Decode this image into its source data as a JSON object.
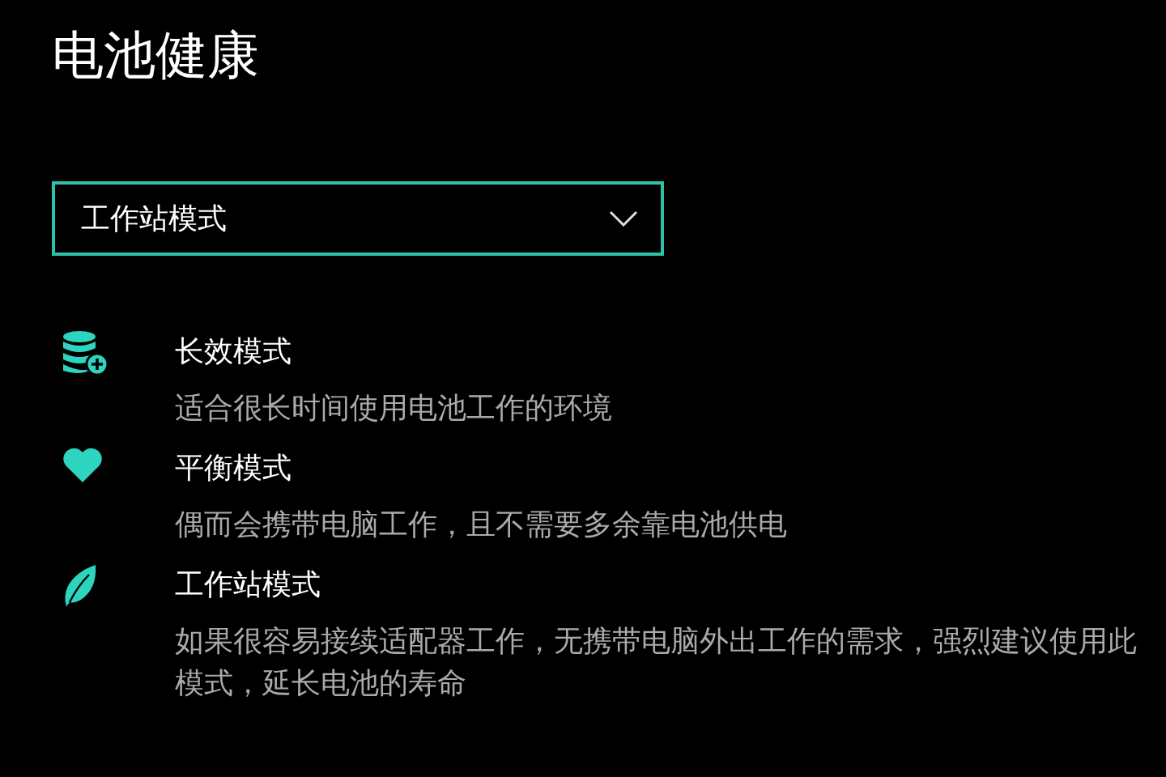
{
  "title": "电池健康",
  "dropdown": {
    "value": "工作站模式"
  },
  "modes": [
    {
      "kind": "database",
      "name": "长效模式",
      "description": "适合很长时间使用电池工作的环境"
    },
    {
      "kind": "heart",
      "name": "平衡模式",
      "description": "偶而会携带电脑工作，且不需要多余靠电池供电"
    },
    {
      "kind": "leaf",
      "name": "工作站模式",
      "description": "如果很容易接续适配器工作，无携带电脑外出工作的需求，强烈建议使用此模式，延长电池的寿命"
    }
  ]
}
